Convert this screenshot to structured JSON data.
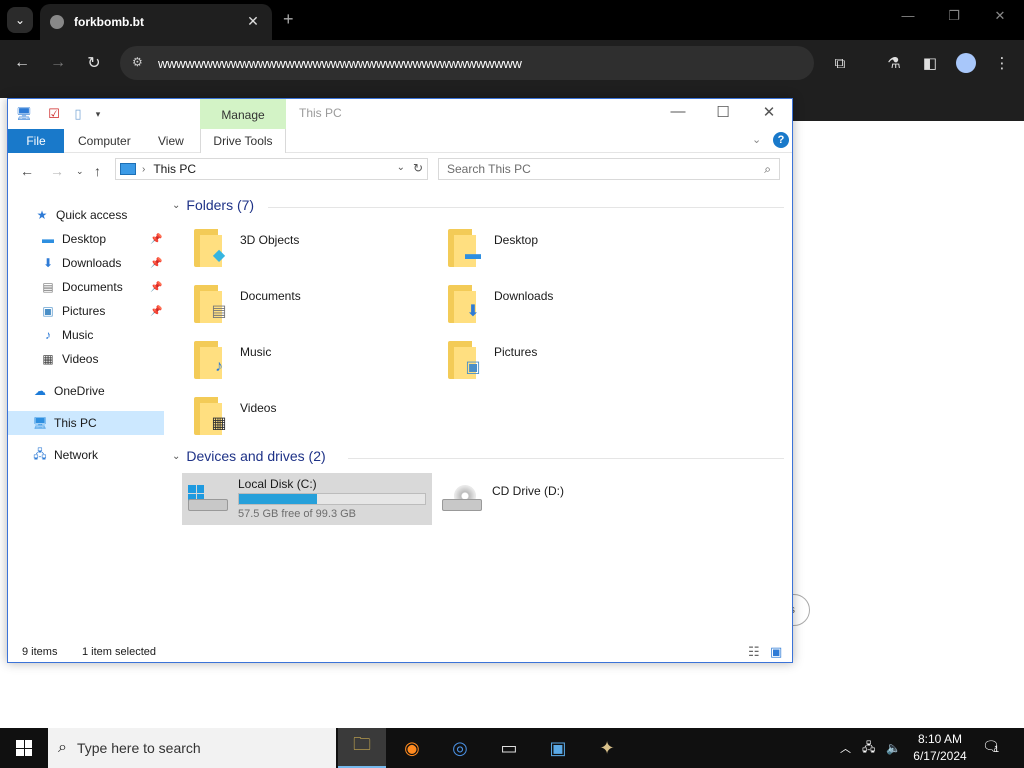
{
  "browser": {
    "tab_title": "forkbomb.bt",
    "tab_close": "✕",
    "new_tab": "+",
    "url": "wwwwwwwwwwwwwwwwwwwwwwwwwwwwwwwwwwwwwwww",
    "minimize": "—",
    "restore": "❐",
    "close": "✕"
  },
  "explorer": {
    "manage_tab": "Manage",
    "title": "This PC",
    "ribbon": {
      "file": "File",
      "computer": "Computer",
      "view": "View",
      "drive_tools": "Drive Tools",
      "help": "?"
    },
    "address": {
      "location": "This PC",
      "search_placeholder": "Search This PC"
    },
    "nav": {
      "quick_access": "Quick access",
      "desktop": "Desktop",
      "downloads": "Downloads",
      "documents": "Documents",
      "pictures": "Pictures",
      "music": "Music",
      "videos": "Videos",
      "onedrive": "OneDrive",
      "this_pc": "This PC",
      "network": "Network"
    },
    "folders_group": "Folders (7)",
    "folders": {
      "objects_3d": "3D Objects",
      "desktop": "Desktop",
      "documents": "Documents",
      "downloads": "Downloads",
      "music": "Music",
      "pictures": "Pictures",
      "videos": "Videos"
    },
    "drives_group": "Devices and drives (2)",
    "drives": {
      "c_name": "Local Disk (C:)",
      "c_free": "57.5 GB free of 99.3 GB",
      "c_used_fraction": 0.42,
      "d_name": "CD Drive (D:)"
    },
    "status": {
      "items": "9 items",
      "selected": "1 item selected"
    }
  },
  "taskbar": {
    "search_placeholder": "Type here to search",
    "time": "8:10 AM",
    "date": "6/17/2024",
    "notification_count": "1"
  }
}
